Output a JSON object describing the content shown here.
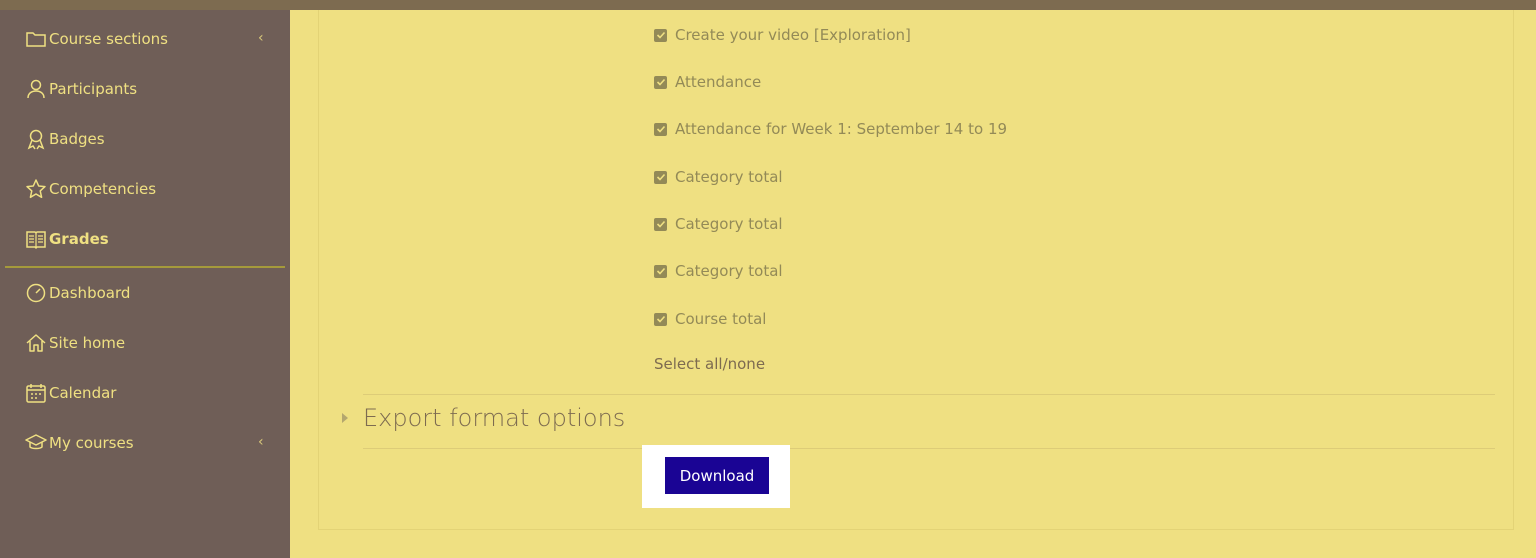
{
  "sidebar": {
    "items": [
      {
        "label": "Course sections",
        "icon": "folder-icon",
        "chevron": "‹"
      },
      {
        "label": "Participants",
        "icon": "user-icon"
      },
      {
        "label": "Badges",
        "icon": "badge-icon"
      },
      {
        "label": "Competencies",
        "icon": "star-icon"
      },
      {
        "label": "Grades",
        "icon": "gradebook-icon",
        "active": true
      },
      {
        "label": "Dashboard",
        "icon": "gauge-icon"
      },
      {
        "label": "Site home",
        "icon": "home-icon"
      },
      {
        "label": "Calendar",
        "icon": "calendar-icon"
      },
      {
        "label": "My courses",
        "icon": "graduation-cap-icon",
        "chevron": "‹"
      }
    ]
  },
  "grade_items": [
    {
      "label": "Create your video [Exploration]",
      "checked": true
    },
    {
      "label": "Attendance",
      "checked": true
    },
    {
      "label": "Attendance for Week 1: September 14 to 19",
      "checked": true
    },
    {
      "label": "Category total",
      "checked": true
    },
    {
      "label": "Category total",
      "checked": true
    },
    {
      "label": "Category total",
      "checked": true
    },
    {
      "label": "Course total",
      "checked": true
    }
  ],
  "select_all_label": "Select all/none",
  "export_section_title": "Export format options",
  "download_label": "Download",
  "colors": {
    "sidebar_bg": "#6f5e57",
    "main_bg": "#efe082",
    "accent": "#1a0494",
    "nav_text": "#efe082"
  }
}
